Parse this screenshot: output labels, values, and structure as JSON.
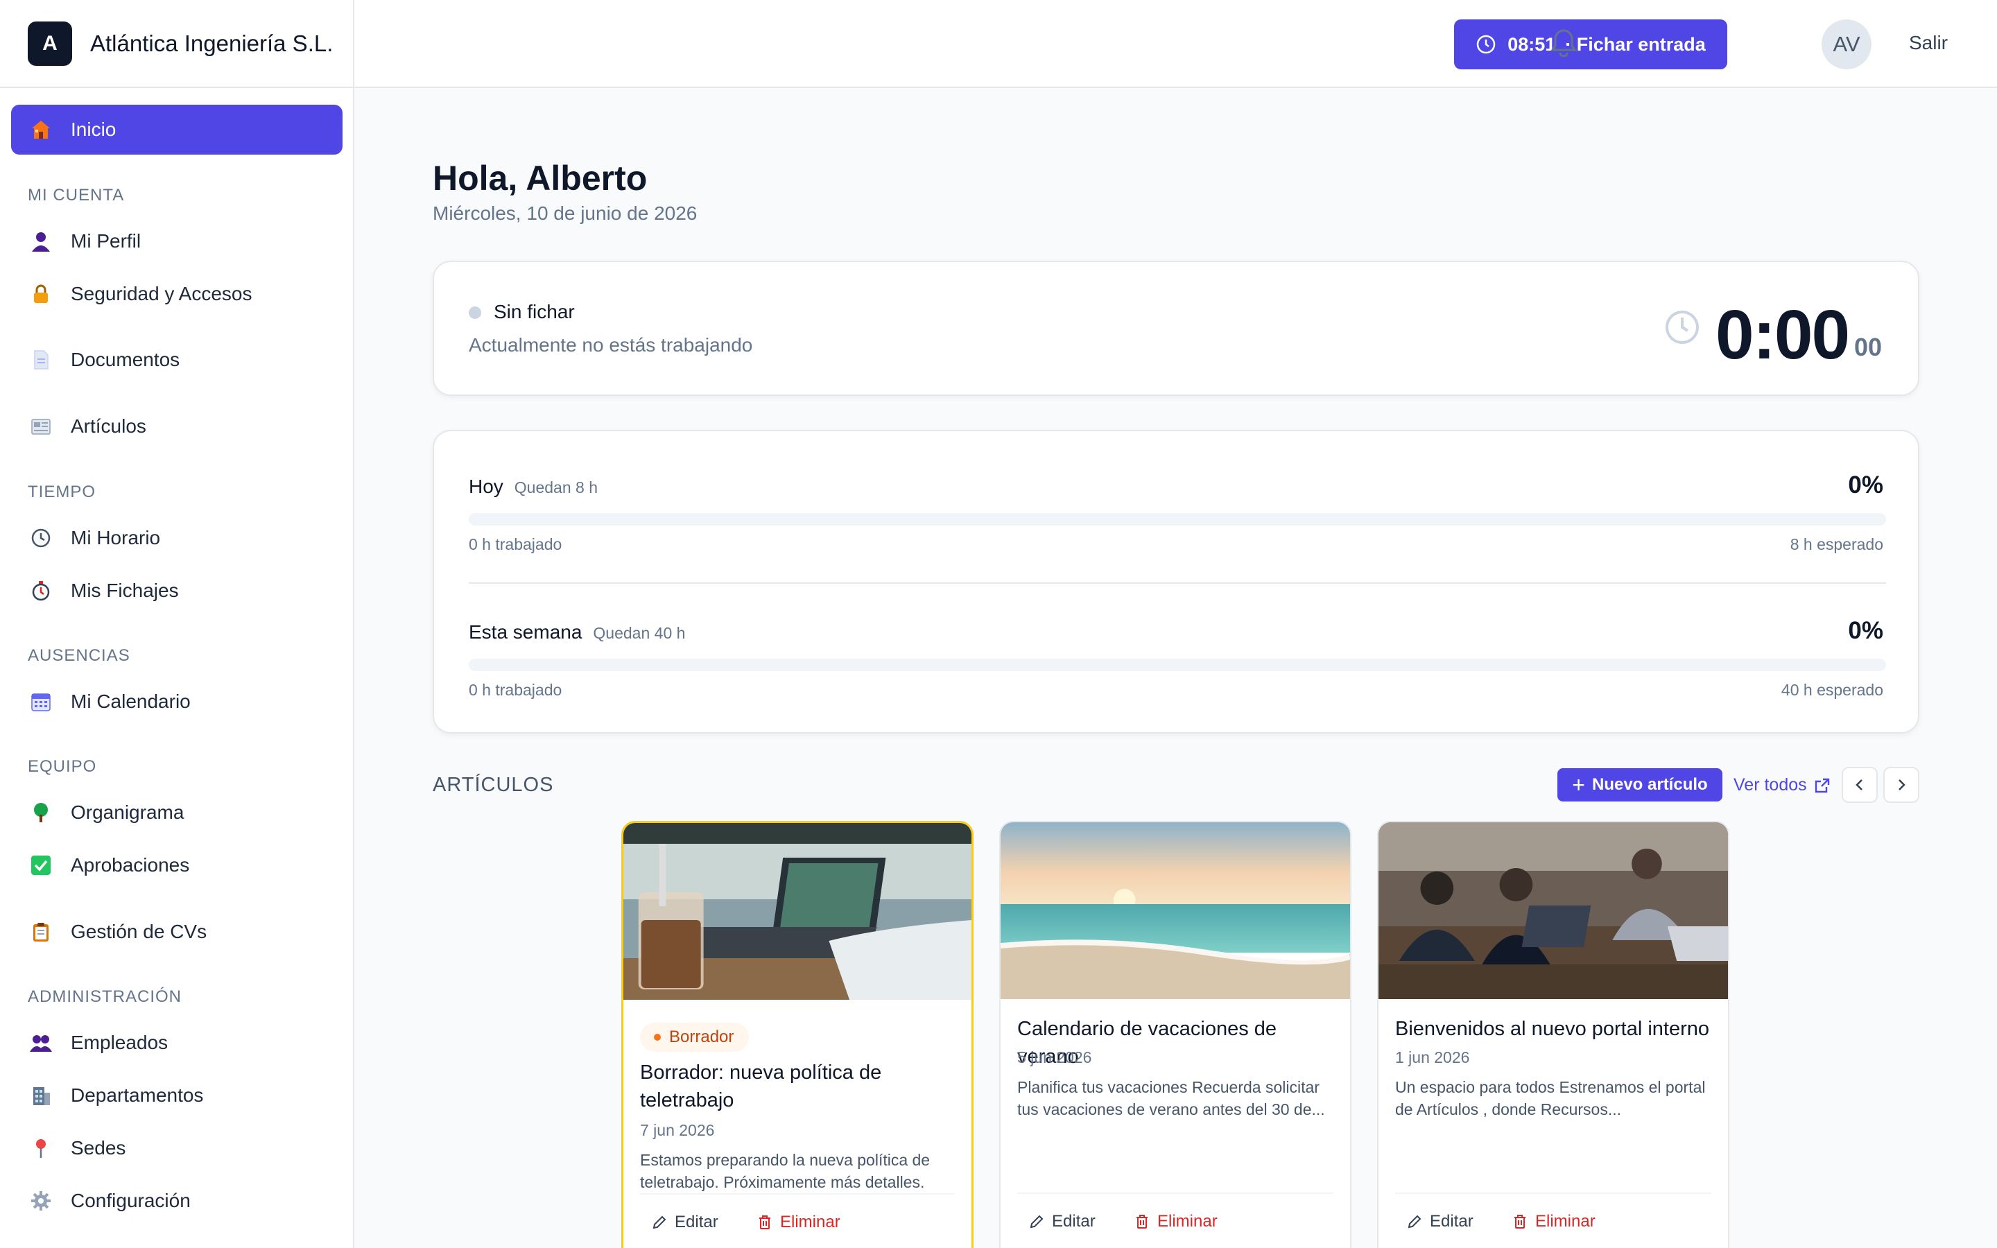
{
  "brand": {
    "logo_letter": "A",
    "name": "Atlántica Ingeniería S.L."
  },
  "sidebar": {
    "home": {
      "label": "Inicio",
      "icon": "house-icon"
    },
    "sections": [
      {
        "label": "MI CUENTA"
      },
      {
        "label": "TIEMPO"
      },
      {
        "label": "AUSENCIAS"
      },
      {
        "label": "EQUIPO"
      },
      {
        "label": "ADMINISTRACIÓN"
      }
    ],
    "items": [
      {
        "label": "Mi Perfil",
        "icon": "user-icon"
      },
      {
        "label": "Seguridad y Accesos",
        "icon": "lock-icon"
      },
      {
        "label": "Documentos",
        "icon": "document-icon"
      },
      {
        "label": "Artículos",
        "icon": "newspaper-icon"
      },
      {
        "label": "Mi Horario",
        "icon": "clock-icon"
      },
      {
        "label": "Mis Fichajes",
        "icon": "stopwatch-icon"
      },
      {
        "label": "Mi Calendario",
        "icon": "calendar-icon"
      },
      {
        "label": "Organigrama",
        "icon": "tree-icon"
      },
      {
        "label": "Aprobaciones",
        "icon": "check-icon"
      },
      {
        "label": "Gestión de CVs",
        "icon": "clipboard-icon"
      },
      {
        "label": "Empleados",
        "icon": "people-icon"
      },
      {
        "label": "Departamentos",
        "icon": "building-icon"
      },
      {
        "label": "Sedes",
        "icon": "pin-icon"
      },
      {
        "label": "Configuración",
        "icon": "gear-icon"
      }
    ]
  },
  "header": {
    "clock_time": "08:51",
    "clock_action": "· Fichar entrada",
    "avatar_initials": "AV",
    "logout_label": "Salir"
  },
  "main": {
    "greeting": "Hola, Alberto",
    "date": "Miércoles, 10 de junio de 2026",
    "status": {
      "title": "Sin fichar",
      "subtitle": "Actualmente no estás trabajando",
      "timer": "0:00",
      "timer_seconds": "00"
    },
    "progress": [
      {
        "title": "Hoy",
        "remaining": "Quedan 8 h",
        "percent": "0%",
        "fraction": 0,
        "worked": "0 h trabajado",
        "expected": "8 h esperado"
      },
      {
        "title": "Esta semana",
        "remaining": "Quedan 40 h",
        "percent": "0%",
        "fraction": 0,
        "worked": "0 h trabajado",
        "expected": "40 h esperado"
      }
    ],
    "articles": {
      "section_label": "ARTÍCULOS",
      "new_label": "Nuevo artículo",
      "see_all_label": "Ver todos",
      "edit_label": "Editar",
      "delete_label": "Eliminar",
      "draft_badge": "Borrador",
      "items": [
        {
          "title": "Borrador: nueva política de teletrabajo",
          "date": "7 jun 2026",
          "excerpt": "Estamos preparando la nueva política de teletrabajo. Próximamente más detalles."
        },
        {
          "title": "Calendario de vacaciones de verano",
          "date": "5 jun 2026",
          "excerpt": "Planifica tus vacaciones Recuerda solicitar tus vacaciones de verano antes del 30 de..."
        },
        {
          "title": "Bienvenidos al nuevo portal interno",
          "date": "1 jun 2026",
          "excerpt": "Un espacio para todos Estrenamos el portal de Artículos , donde Recursos..."
        }
      ]
    }
  },
  "colors": {
    "accent": "#4f46e5",
    "danger": "#dc2626",
    "draft_border": "#facc15"
  }
}
